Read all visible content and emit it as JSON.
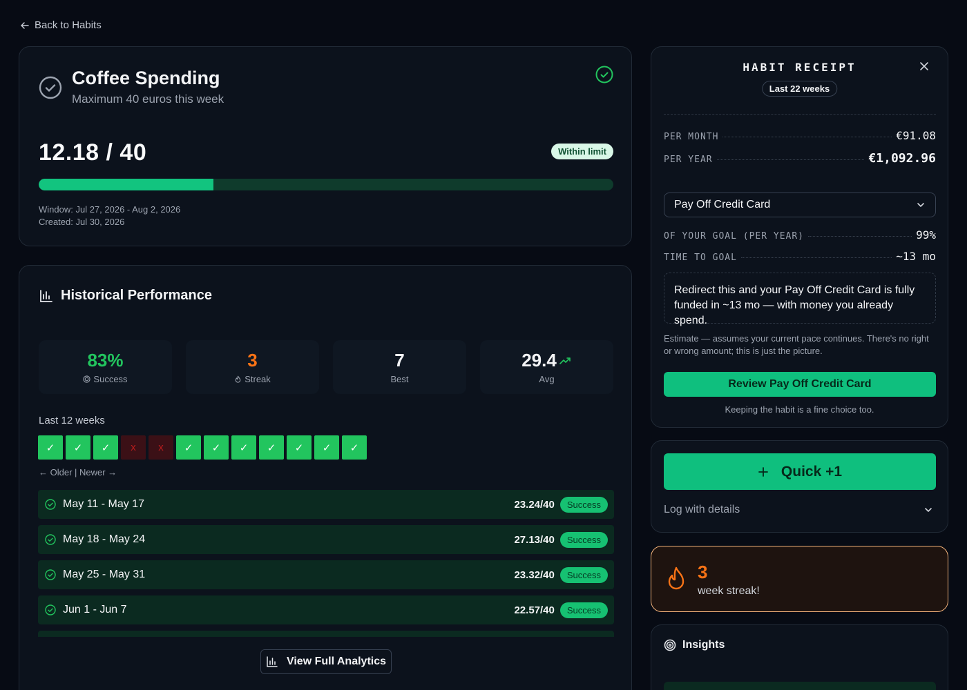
{
  "nav": {
    "back_label": "Back to Habits"
  },
  "habit": {
    "title": "Coffee Spending",
    "subtitle": "Maximum 40 euros this week",
    "progress_text": "12.18 / 40",
    "progress_fraction": 0.3045,
    "status_badge": "Within limit",
    "window": "Window: Jul 27, 2026 - Aug 2, 2026",
    "created": "Created: Jul 30, 2026"
  },
  "history": {
    "title": "Historical Performance",
    "stats": [
      {
        "value": "83%",
        "label": "Success",
        "color": "#22c55e",
        "icon": "target-icon"
      },
      {
        "value": "3",
        "label": "Streak",
        "color": "#f97316",
        "icon": "flame-icon"
      },
      {
        "value": "7",
        "label": "Best",
        "color": "#f3f4f6",
        "icon": ""
      },
      {
        "value": "29.4",
        "label": "Avg",
        "color": "#f3f4f6",
        "icon": "trending-up-icon"
      }
    ],
    "weeks_label": "Last 12 weeks",
    "weeks": [
      {
        "status": "success",
        "mark": "✓"
      },
      {
        "status": "success",
        "mark": "✓"
      },
      {
        "status": "success",
        "mark": "✓"
      },
      {
        "status": "fail",
        "mark": "x"
      },
      {
        "status": "fail",
        "mark": "x"
      },
      {
        "status": "success",
        "mark": "✓"
      },
      {
        "status": "success",
        "mark": "✓"
      },
      {
        "status": "success",
        "mark": "✓"
      },
      {
        "status": "success",
        "mark": "✓"
      },
      {
        "status": "success",
        "mark": "✓"
      },
      {
        "status": "success",
        "mark": "✓"
      },
      {
        "status": "success",
        "mark": "✓"
      }
    ],
    "older_newer": "← Older | Newer →",
    "rows": [
      {
        "dates": "May 11 - May 17",
        "score": "23.24/40",
        "badge": "Success"
      },
      {
        "dates": "May 18 - May 24",
        "score": "27.13/40",
        "badge": "Success"
      },
      {
        "dates": "May 25 - May 31",
        "score": "23.32/40",
        "badge": "Success"
      },
      {
        "dates": "Jun 1 - Jun 7",
        "score": "22.57/40",
        "badge": "Success"
      }
    ],
    "analytics_button": "View Full Analytics"
  },
  "receipt": {
    "title": "HABIT RECEIPT",
    "period": "Last 22 weeks",
    "per_month_label": "PER MONTH",
    "per_month_value": "€91.08",
    "per_year_label": "PER YEAR",
    "per_year_value": "€1,092.96",
    "goal_selected": "Pay Off Credit Card",
    "of_goal_label": "OF YOUR GOAL (PER YEAR)",
    "of_goal_value": "99%",
    "time_to_goal_label": "TIME TO GOAL",
    "time_to_goal_value": "~13 mo",
    "redirect_text": "Redirect this and your Pay Off Credit Card is fully funded in ~13 mo — with money you already spend.",
    "estimate_text": "Estimate — assumes your current pace continues. There's no right or wrong amount; this is just the picture.",
    "review_button": "Review Pay Off Credit Card",
    "keeping_text": "Keeping the habit is a fine choice too."
  },
  "quick": {
    "button_label": "Quick +1",
    "log_details": "Log with details"
  },
  "streak": {
    "count": "3",
    "label": "week streak!"
  },
  "insights": {
    "title": "Insights"
  },
  "colors": {
    "accent": "#0fbf7e",
    "success": "#22c55e",
    "fail_bg": "#3b1016",
    "streak": "#f97316"
  }
}
